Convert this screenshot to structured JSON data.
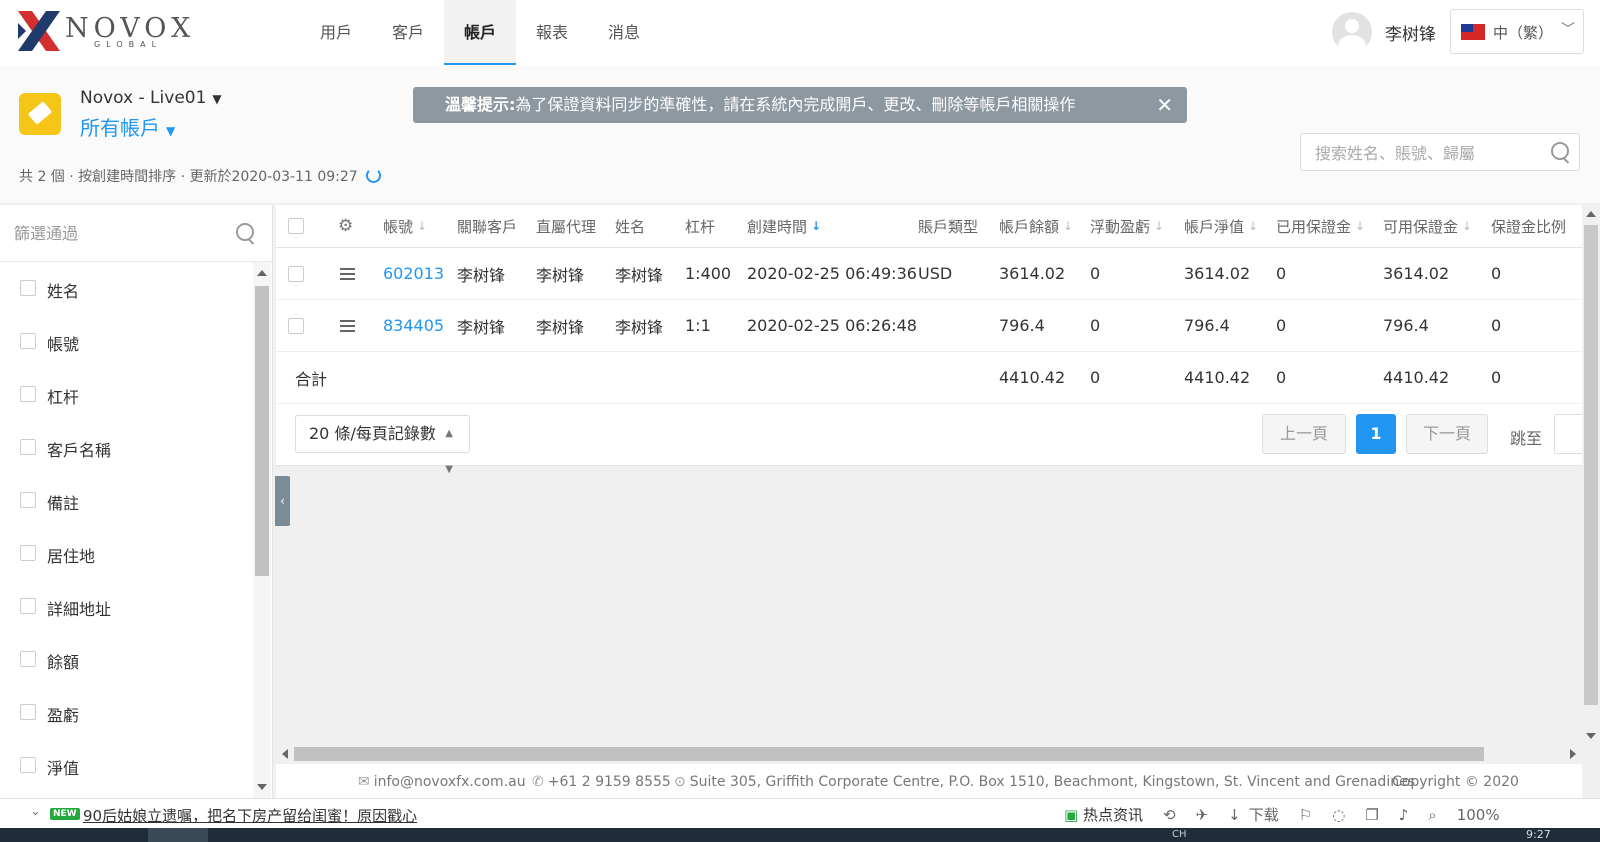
{
  "header": {
    "logo_name": "NOVOX",
    "logo_sub": "GLOBAL",
    "nav": [
      {
        "label": "用戶"
      },
      {
        "label": "客戶"
      },
      {
        "label": "帳戶"
      },
      {
        "label": "報表"
      },
      {
        "label": "消息"
      }
    ],
    "active_nav": "帳戶",
    "username": "李树锋",
    "language": "中（繁）"
  },
  "subheader": {
    "server": "Novox - Live01",
    "account_filter": "所有帳戶",
    "notice_title": "溫馨提示:",
    "notice_text": "為了保證資料同步的準確性，請在系統內完成開戶、更改、刪除等帳戶相關操作",
    "search_placeholder": "搜索姓名、賬號、歸屬",
    "meta": "共 2 個 · 按創建時間排序 · 更新於2020-03-11 09:27"
  },
  "sidebar": {
    "filter_placeholder": "篩選通過",
    "items": [
      {
        "label": "姓名"
      },
      {
        "label": "帳號"
      },
      {
        "label": "杠杆"
      },
      {
        "label": "客戶名稱"
      },
      {
        "label": "備註"
      },
      {
        "label": "居住地"
      },
      {
        "label": "詳細地址"
      },
      {
        "label": "餘額"
      },
      {
        "label": "盈虧"
      },
      {
        "label": "淨值"
      }
    ]
  },
  "table": {
    "columns": {
      "account": "帳號",
      "linked_client": "關聯客戶",
      "agent": "直屬代理",
      "name": "姓名",
      "leverage": "杠杆",
      "created": "創建時間",
      "type": "賬戶類型",
      "balance": "帳戶餘額",
      "floating": "浮動盈虧",
      "equity": "帳戶淨值",
      "used_margin": "已用保證金",
      "free_margin": "可用保證金",
      "margin_ratio": "保證金比例"
    },
    "rows": [
      {
        "account": "602013",
        "linked_client": "李树锋",
        "agent": "李树锋",
        "name": "李树锋",
        "leverage": "1:400",
        "created": "2020-02-25 06:49:36",
        "type": "USD",
        "balance": "3614.02",
        "floating": "0",
        "equity": "3614.02",
        "used_margin": "0",
        "free_margin": "3614.02",
        "margin_ratio": "0"
      },
      {
        "account": "834405",
        "linked_client": "李树锋",
        "agent": "李树锋",
        "name": "李树锋",
        "leverage": "1:1",
        "created": "2020-02-25 06:26:48",
        "type": "",
        "balance": "796.4",
        "floating": "0",
        "equity": "796.4",
        "used_margin": "0",
        "free_margin": "796.4",
        "margin_ratio": "0"
      }
    ],
    "total": {
      "label": "合計",
      "balance": "4410.42",
      "floating": "0",
      "equity": "4410.42",
      "used_margin": "0",
      "free_margin": "4410.42",
      "margin_ratio": "0"
    }
  },
  "pagination": {
    "page_size": "20 條/每頁記錄數",
    "prev": "上一頁",
    "current": "1",
    "next": "下一頁",
    "jump": "跳至"
  },
  "footer": {
    "email": "info@novoxfx.com.au",
    "phone": "+61 2 9159 8555",
    "address": "Suite 305, Griffith Corporate Centre, P.O. Box 1510, Beachmont, Kingstown, St. Vincent and Grenadines",
    "copyright": "Copyright © 2020"
  },
  "browser_status": {
    "badge": "NEW",
    "news": "90后姑娘立遗嘱，把名下房产留给闺蜜！原因戳心",
    "hot": "热点资讯",
    "download": "下载",
    "zoom": "100%"
  },
  "taskbar": {
    "ime": "CH",
    "clock": "9:27"
  },
  "colors": {
    "accent": "#2196f3",
    "notice_bg": "#8d98a0",
    "logo_red": "#d32f2f",
    "logo_navy": "#1f3a6b"
  }
}
